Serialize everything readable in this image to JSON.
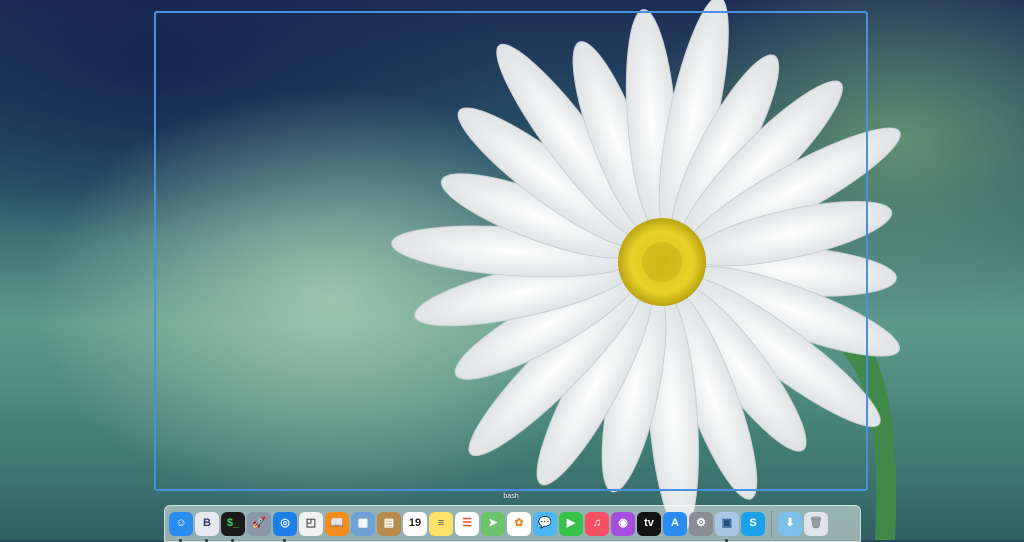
{
  "selection": {
    "label": "bash"
  },
  "dock": {
    "items": [
      {
        "name": "finder",
        "glyph": "☺",
        "bg": "#2b8cf0",
        "fg": "#ffffff",
        "running": true
      },
      {
        "name": "bbedit",
        "glyph": "B",
        "bg": "#e6e9ef",
        "fg": "#2a3a6a",
        "running": true
      },
      {
        "name": "terminal",
        "glyph": "$_",
        "bg": "#1b1b1b",
        "fg": "#3cd35a",
        "running": true
      },
      {
        "name": "launchpad",
        "glyph": "🚀",
        "bg": "#8a97a8",
        "fg": "#ffffff",
        "running": false
      },
      {
        "name": "safari",
        "glyph": "◎",
        "bg": "#1c7fe8",
        "fg": "#ffffff",
        "running": true
      },
      {
        "name": "screenshot",
        "glyph": "◰",
        "bg": "#f1f1f1",
        "fg": "#444444",
        "running": false
      },
      {
        "name": "books",
        "glyph": "📖",
        "bg": "#f28c1f",
        "fg": "#ffffff",
        "running": false
      },
      {
        "name": "preview",
        "glyph": "▦",
        "bg": "#6fa3d8",
        "fg": "#ffffff",
        "running": false
      },
      {
        "name": "notefile",
        "glyph": "▤",
        "bg": "#b68b4c",
        "fg": "#ffffff",
        "running": false
      },
      {
        "name": "calendar",
        "glyph": "19",
        "bg": "#ffffff",
        "fg": "#222222",
        "running": false
      },
      {
        "name": "notes",
        "glyph": "≡",
        "bg": "#fde36a",
        "fg": "#555555",
        "running": false
      },
      {
        "name": "reminders",
        "glyph": "☰",
        "bg": "#ffffff",
        "fg": "#e2533a",
        "running": false
      },
      {
        "name": "maps",
        "glyph": "➤",
        "bg": "#6cc26a",
        "fg": "#ffffff",
        "running": false
      },
      {
        "name": "photos",
        "glyph": "✿",
        "bg": "#ffffff",
        "fg": "#e8862a",
        "running": false
      },
      {
        "name": "messages",
        "glyph": "💬",
        "bg": "#4bb8f5",
        "fg": "#ffffff",
        "running": false
      },
      {
        "name": "facetime",
        "glyph": "▶",
        "bg": "#36c24a",
        "fg": "#ffffff",
        "running": false
      },
      {
        "name": "music",
        "glyph": "♫",
        "bg": "#fa4e63",
        "fg": "#ffffff",
        "running": false
      },
      {
        "name": "podcasts",
        "glyph": "◉",
        "bg": "#a44ee0",
        "fg": "#ffffff",
        "running": false
      },
      {
        "name": "apple-tv",
        "glyph": "tv",
        "bg": "#111111",
        "fg": "#ffffff",
        "running": false
      },
      {
        "name": "app-store",
        "glyph": "A",
        "bg": "#2a8cf0",
        "fg": "#ffffff",
        "running": false
      },
      {
        "name": "system-preferences",
        "glyph": "⚙",
        "bg": "#8a8d93",
        "fg": "#ffffff",
        "running": false
      },
      {
        "name": "virtualbox",
        "glyph": "▣",
        "bg": "#a9c6e6",
        "fg": "#1f4f8a",
        "running": true
      },
      {
        "name": "skype",
        "glyph": "S",
        "bg": "#1ba1e8",
        "fg": "#ffffff",
        "running": false
      }
    ],
    "right_items": [
      {
        "name": "downloads-folder",
        "glyph": "⬇",
        "bg": "#7cc0ea",
        "fg": "#ffffff"
      },
      {
        "name": "trash",
        "glyph": "🗑",
        "bg": "#dfe4e8",
        "fg": "#8a9099"
      }
    ]
  }
}
